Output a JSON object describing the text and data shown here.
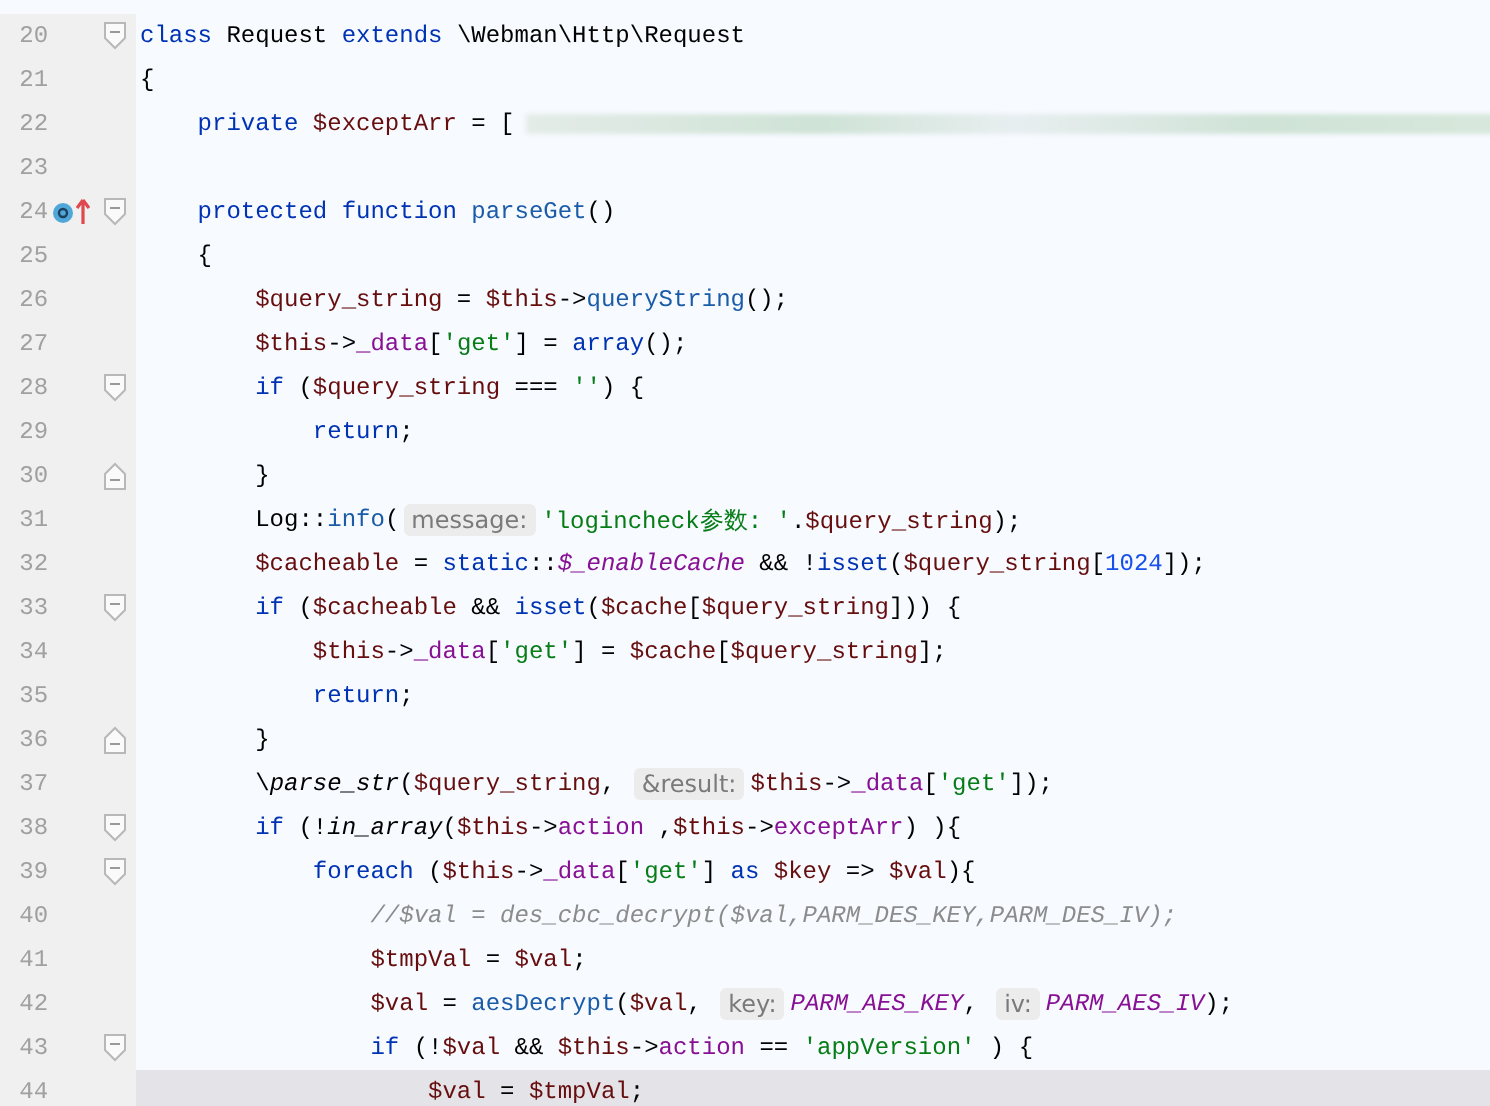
{
  "editor": {
    "lines": [
      {
        "number": "20",
        "fold_open": true,
        "fold_close": false,
        "marker": false,
        "current": false,
        "redacted": false,
        "segments": [
          {
            "kind": "kw",
            "text": "class"
          },
          {
            "kind": "plain",
            "text": " Request "
          },
          {
            "kind": "kw",
            "text": "extends"
          },
          {
            "kind": "plain",
            "text": " \\Webman\\Http\\Request"
          }
        ]
      },
      {
        "number": "21",
        "fold_open": false,
        "fold_close": false,
        "marker": false,
        "current": false,
        "redacted": false,
        "segments": [
          {
            "kind": "plain",
            "text": "{"
          }
        ]
      },
      {
        "number": "22",
        "fold_open": false,
        "fold_close": false,
        "marker": false,
        "current": false,
        "redacted": true,
        "segments": [
          {
            "kind": "kw",
            "text": "    private "
          },
          {
            "kind": "var",
            "text": "$exceptArr"
          },
          {
            "kind": "plain",
            "text": " = ["
          }
        ]
      },
      {
        "number": "23",
        "fold_open": false,
        "fold_close": false,
        "marker": false,
        "current": false,
        "redacted": false
      },
      {
        "number": "24",
        "fold_open": true,
        "fold_close": false,
        "marker": true,
        "current": false,
        "redacted": false,
        "segments": [
          {
            "kind": "kw",
            "text": "    protected function "
          },
          {
            "kind": "fn",
            "text": "parseGet"
          },
          {
            "kind": "plain",
            "text": "()"
          }
        ]
      },
      {
        "number": "25",
        "fold_open": false,
        "fold_close": false,
        "marker": false,
        "current": false,
        "redacted": false,
        "segments": [
          {
            "kind": "plain",
            "text": "    {"
          }
        ]
      },
      {
        "number": "26",
        "fold_open": false,
        "fold_close": false,
        "marker": false,
        "current": false,
        "redacted": false,
        "segments": [
          {
            "kind": "var",
            "text": "        $query_string"
          },
          {
            "kind": "plain",
            "text": " = "
          },
          {
            "kind": "var",
            "text": "$this"
          },
          {
            "kind": "plain",
            "text": "->"
          },
          {
            "kind": "fn",
            "text": "queryString"
          },
          {
            "kind": "plain",
            "text": "();"
          }
        ]
      },
      {
        "number": "27",
        "fold_open": false,
        "fold_close": false,
        "marker": false,
        "current": false,
        "redacted": false,
        "segments": [
          {
            "kind": "var",
            "text": "        $this"
          },
          {
            "kind": "plain",
            "text": "->"
          },
          {
            "kind": "field",
            "text": "_data"
          },
          {
            "kind": "plain",
            "text": "["
          },
          {
            "kind": "str",
            "text": "'get'"
          },
          {
            "kind": "plain",
            "text": "] = "
          },
          {
            "kind": "kw",
            "text": "array"
          },
          {
            "kind": "plain",
            "text": "();"
          }
        ]
      },
      {
        "number": "28",
        "fold_open": true,
        "fold_close": false,
        "marker": false,
        "current": false,
        "redacted": false,
        "segments": [
          {
            "kind": "kw",
            "text": "        if"
          },
          {
            "kind": "plain",
            "text": " ("
          },
          {
            "kind": "var",
            "text": "$query_string"
          },
          {
            "kind": "plain",
            "text": " === "
          },
          {
            "kind": "str",
            "text": "''"
          },
          {
            "kind": "plain",
            "text": ") {"
          }
        ]
      },
      {
        "number": "29",
        "fold_open": false,
        "fold_close": false,
        "marker": false,
        "current": false,
        "redacted": false,
        "segments": [
          {
            "kind": "kw",
            "text": "            return"
          },
          {
            "kind": "plain",
            "text": ";"
          }
        ]
      },
      {
        "number": "30",
        "fold_open": false,
        "fold_close": true,
        "marker": false,
        "current": false,
        "redacted": false,
        "segments": [
          {
            "kind": "plain",
            "text": "        }"
          }
        ]
      },
      {
        "number": "31",
        "fold_open": false,
        "fold_close": false,
        "marker": false,
        "current": false,
        "redacted": false,
        "segments": [
          {
            "kind": "plain",
            "text": "        Log::"
          },
          {
            "kind": "fn",
            "text": "info"
          },
          {
            "kind": "plain",
            "text": "("
          },
          {
            "kind": "hint",
            "text": "message:"
          },
          {
            "kind": "str",
            "text": "'logincheck参数: '"
          },
          {
            "kind": "plain",
            "text": "."
          },
          {
            "kind": "var",
            "text": "$query_string"
          },
          {
            "kind": "plain",
            "text": ");"
          }
        ]
      },
      {
        "number": "32",
        "fold_open": false,
        "fold_close": false,
        "marker": false,
        "current": false,
        "redacted": false,
        "segments": [
          {
            "kind": "var",
            "text": "        $cacheable"
          },
          {
            "kind": "plain",
            "text": " = "
          },
          {
            "kind": "kw",
            "text": "static"
          },
          {
            "kind": "plain",
            "text": "::"
          },
          {
            "kind": "const",
            "text": "$_enableCache"
          },
          {
            "kind": "plain",
            "text": " && !"
          },
          {
            "kind": "kw",
            "text": "isset"
          },
          {
            "kind": "plain",
            "text": "("
          },
          {
            "kind": "var",
            "text": "$query_string"
          },
          {
            "kind": "plain",
            "text": "["
          },
          {
            "kind": "num",
            "text": "1024"
          },
          {
            "kind": "plain",
            "text": "]);"
          }
        ]
      },
      {
        "number": "33",
        "fold_open": true,
        "fold_close": false,
        "marker": false,
        "current": false,
        "redacted": false,
        "segments": [
          {
            "kind": "kw",
            "text": "        if"
          },
          {
            "kind": "plain",
            "text": " ("
          },
          {
            "kind": "var",
            "text": "$cacheable"
          },
          {
            "kind": "plain",
            "text": " && "
          },
          {
            "kind": "kw",
            "text": "isset"
          },
          {
            "kind": "plain",
            "text": "("
          },
          {
            "kind": "var",
            "text": "$cache"
          },
          {
            "kind": "plain",
            "text": "["
          },
          {
            "kind": "var",
            "text": "$query_string"
          },
          {
            "kind": "plain",
            "text": "])) {"
          }
        ]
      },
      {
        "number": "34",
        "fold_open": false,
        "fold_close": false,
        "marker": false,
        "current": false,
        "redacted": false,
        "segments": [
          {
            "kind": "var",
            "text": "            $this"
          },
          {
            "kind": "plain",
            "text": "->"
          },
          {
            "kind": "field",
            "text": "_data"
          },
          {
            "kind": "plain",
            "text": "["
          },
          {
            "kind": "str",
            "text": "'get'"
          },
          {
            "kind": "plain",
            "text": "] = "
          },
          {
            "kind": "var",
            "text": "$cache"
          },
          {
            "kind": "plain",
            "text": "["
          },
          {
            "kind": "var",
            "text": "$query_string"
          },
          {
            "kind": "plain",
            "text": "];"
          }
        ]
      },
      {
        "number": "35",
        "fold_open": false,
        "fold_close": false,
        "marker": false,
        "current": false,
        "redacted": false,
        "segments": [
          {
            "kind": "kw",
            "text": "            return"
          },
          {
            "kind": "plain",
            "text": ";"
          }
        ]
      },
      {
        "number": "36",
        "fold_open": false,
        "fold_close": true,
        "marker": false,
        "current": false,
        "redacted": false,
        "segments": [
          {
            "kind": "plain",
            "text": "        }"
          }
        ]
      },
      {
        "number": "37",
        "fold_open": false,
        "fold_close": false,
        "marker": false,
        "current": false,
        "redacted": false,
        "segments": [
          {
            "kind": "plain",
            "text": "        \\"
          },
          {
            "kind": "italic",
            "text": "parse_str"
          },
          {
            "kind": "plain",
            "text": "("
          },
          {
            "kind": "var",
            "text": "$query_string"
          },
          {
            "kind": "plain",
            "text": ", "
          },
          {
            "kind": "hint",
            "text": "&result:"
          },
          {
            "kind": "var",
            "text": "$this"
          },
          {
            "kind": "plain",
            "text": "->"
          },
          {
            "kind": "field",
            "text": "_data"
          },
          {
            "kind": "plain",
            "text": "["
          },
          {
            "kind": "str",
            "text": "'get'"
          },
          {
            "kind": "plain",
            "text": "]);"
          }
        ]
      },
      {
        "number": "38",
        "fold_open": true,
        "fold_close": false,
        "marker": false,
        "current": false,
        "redacted": false,
        "segments": [
          {
            "kind": "kw",
            "text": "        if"
          },
          {
            "kind": "plain",
            "text": " (!"
          },
          {
            "kind": "italic",
            "text": "in_array"
          },
          {
            "kind": "plain",
            "text": "("
          },
          {
            "kind": "var",
            "text": "$this"
          },
          {
            "kind": "plain",
            "text": "->"
          },
          {
            "kind": "field",
            "text": "action"
          },
          {
            "kind": "plain",
            "text": " ,"
          },
          {
            "kind": "var",
            "text": "$this"
          },
          {
            "kind": "plain",
            "text": "->"
          },
          {
            "kind": "field",
            "text": "exceptArr"
          },
          {
            "kind": "plain",
            "text": ") ){"
          }
        ]
      },
      {
        "number": "39",
        "fold_open": true,
        "fold_close": false,
        "marker": false,
        "current": false,
        "redacted": false,
        "segments": [
          {
            "kind": "kw",
            "text": "            foreach"
          },
          {
            "kind": "plain",
            "text": " ("
          },
          {
            "kind": "var",
            "text": "$this"
          },
          {
            "kind": "plain",
            "text": "->"
          },
          {
            "kind": "field",
            "text": "_data"
          },
          {
            "kind": "plain",
            "text": "["
          },
          {
            "kind": "str",
            "text": "'get'"
          },
          {
            "kind": "plain",
            "text": "] "
          },
          {
            "kind": "kw",
            "text": "as "
          },
          {
            "kind": "var",
            "text": "$key"
          },
          {
            "kind": "plain",
            "text": " => "
          },
          {
            "kind": "var",
            "text": "$val"
          },
          {
            "kind": "plain",
            "text": "){"
          }
        ]
      },
      {
        "number": "40",
        "fold_open": false,
        "fold_close": false,
        "marker": false,
        "current": false,
        "redacted": false,
        "segments": [
          {
            "kind": "cmt",
            "text": "                //$val = des_cbc_decrypt($val,PARM_DES_KEY,PARM_DES_IV);"
          }
        ]
      },
      {
        "number": "41",
        "fold_open": false,
        "fold_close": false,
        "marker": false,
        "current": false,
        "redacted": false,
        "segments": [
          {
            "kind": "var",
            "text": "                $tmpVal"
          },
          {
            "kind": "plain",
            "text": " = "
          },
          {
            "kind": "var",
            "text": "$val"
          },
          {
            "kind": "plain",
            "text": ";"
          }
        ]
      },
      {
        "number": "42",
        "fold_open": false,
        "fold_close": false,
        "marker": false,
        "current": false,
        "redacted": false,
        "segments": [
          {
            "kind": "var",
            "text": "                $val"
          },
          {
            "kind": "plain",
            "text": " = "
          },
          {
            "kind": "fn",
            "text": "aesDecrypt"
          },
          {
            "kind": "plain",
            "text": "("
          },
          {
            "kind": "var",
            "text": "$val"
          },
          {
            "kind": "plain",
            "text": ", "
          },
          {
            "kind": "hint",
            "text": "key:"
          },
          {
            "kind": "const",
            "text": "PARM_AES_KEY"
          },
          {
            "kind": "plain",
            "text": ", "
          },
          {
            "kind": "hint",
            "text": "iv:"
          },
          {
            "kind": "const",
            "text": "PARM_AES_IV"
          },
          {
            "kind": "plain",
            "text": ");"
          }
        ]
      },
      {
        "number": "43",
        "fold_open": true,
        "fold_close": false,
        "marker": false,
        "current": false,
        "redacted": false,
        "segments": [
          {
            "kind": "kw",
            "text": "                if"
          },
          {
            "kind": "plain",
            "text": " (!"
          },
          {
            "kind": "var",
            "text": "$val"
          },
          {
            "kind": "plain",
            "text": " && "
          },
          {
            "kind": "var",
            "text": "$this"
          },
          {
            "kind": "plain",
            "text": "->"
          },
          {
            "kind": "field",
            "text": "action"
          },
          {
            "kind": "plain",
            "text": " == "
          },
          {
            "kind": "str",
            "text": "'appVersion'"
          },
          {
            "kind": "plain",
            "text": " ) {"
          }
        ]
      },
      {
        "number": "44",
        "fold_open": false,
        "fold_close": false,
        "marker": false,
        "current": true,
        "redacted": false,
        "segments": [
          {
            "kind": "var",
            "text": "                    $val"
          },
          {
            "kind": "plain",
            "text": " = "
          },
          {
            "kind": "var",
            "text": "$tmpVal"
          },
          {
            "kind": "plain",
            "text": ";"
          }
        ]
      }
    ]
  }
}
